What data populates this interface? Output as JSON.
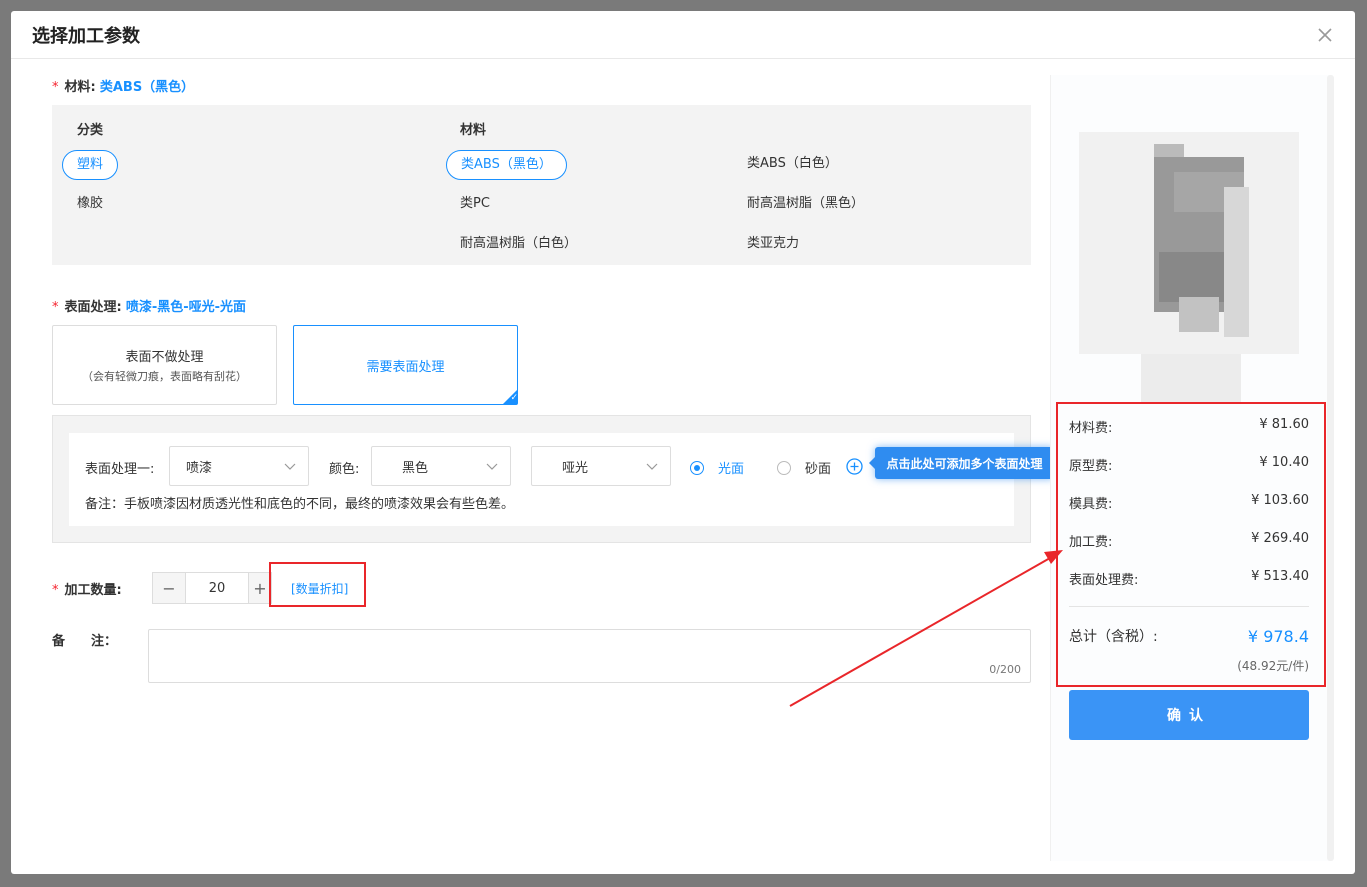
{
  "dialog": {
    "title": "选择加工参数"
  },
  "material": {
    "label": "材料:",
    "selected": "类ABS（黑色）",
    "category_header": "分类",
    "material_header": "材料",
    "categories": [
      "塑料",
      "橡胶"
    ],
    "items": [
      "类ABS（黑色）",
      "类ABS（白色）",
      "类PC",
      "耐高温树脂（黑色）",
      "耐高温树脂（白色）",
      "类亚克力"
    ]
  },
  "surface": {
    "label": "表面处理:",
    "selected": "喷漆-黑色-哑光-光面",
    "option_none_title": "表面不做处理",
    "option_none_desc": "（会有轻微刀痕，表面略有刮花）",
    "option_need": "需要表面处理",
    "process_label": "表面处理一:",
    "process_value": "喷漆",
    "color_label": "颜色:",
    "color_value": "黑色",
    "finish_value": "哑光",
    "radio_glossy": "光面",
    "radio_matte": "砂面",
    "note": "备注：手板喷漆因材质透光性和底色的不同，最终的喷漆效果会有些色差。",
    "tooltip": "点击此处可添加多个表面处理"
  },
  "quantity": {
    "label": "加工数量:",
    "value": "20",
    "minus": "−",
    "plus": "+",
    "discount_link": "[数量折扣]"
  },
  "remark": {
    "label": "备　　注：",
    "count": "0/200"
  },
  "prices": [
    {
      "label": "材料费:",
      "value": "¥ 81.60"
    },
    {
      "label": "原型费:",
      "value": "¥ 10.40"
    },
    {
      "label": "模具费:",
      "value": "¥ 103.60"
    },
    {
      "label": "加工费:",
      "value": "¥ 269.40"
    },
    {
      "label": "表面处理费:",
      "value": "¥ 513.40"
    }
  ],
  "total": {
    "label": "总计（含税）:",
    "value": "¥ 978.4",
    "per_unit": "(48.92元/件)"
  },
  "confirm_label": "确认",
  "colors": {
    "accent": "#1890ff",
    "annotation_red": "#e9262a",
    "confirm_bg": "#3a94f6"
  }
}
